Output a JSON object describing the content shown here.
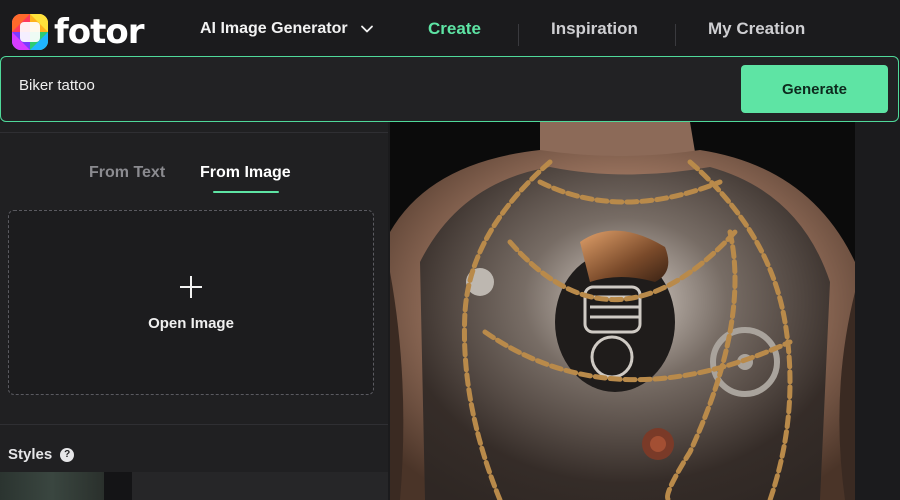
{
  "brand": {
    "name": "fotor"
  },
  "nav": {
    "generator_label": "AI Image Generator",
    "create_label": "Create",
    "inspiration_label": "Inspiration",
    "my_creation_label": "My Creation"
  },
  "prompt": {
    "value": "Biker tattoo",
    "generate_label": "Generate"
  },
  "source_tabs": [
    {
      "label": "From Text",
      "active": false
    },
    {
      "label": "From Image",
      "active": true
    }
  ],
  "upload": {
    "label": "Open Image",
    "icon": "plus-icon"
  },
  "styles": {
    "label": "Styles",
    "help_glyph": "?"
  },
  "colors": {
    "accent": "#5ee4a4",
    "background": "#1b1b1d",
    "panel": "#202022"
  },
  "result_image": {
    "subject": "biker-tattoo-back"
  }
}
